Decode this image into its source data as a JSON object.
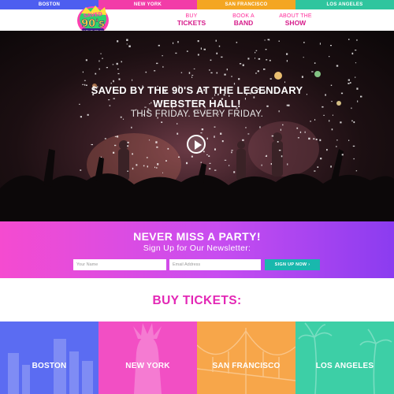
{
  "city_strip": [
    "BOSTON",
    "NEW YORK",
    "SAN FRANCISCO",
    "LOS ANGELES"
  ],
  "logo": {
    "text": "SAVED BY THE 90's"
  },
  "nav": [
    {
      "small": "BUY",
      "big": "TICKETS"
    },
    {
      "small": "BOOK A",
      "big": "BAND"
    },
    {
      "small": "ABOUT THE",
      "big": "SHOW"
    }
  ],
  "hero": {
    "title_line1": "SAVED BY THE 90'S AT THE LEGENDARY",
    "title_line2": "WEBSTER HALL!",
    "subtitle": "THIS FRIDAY. EVERY FRIDAY."
  },
  "newsletter": {
    "title": "NEVER MISS A PARTY!",
    "subtitle": "Sign Up for Our Newsletter:",
    "name_placeholder": "Your Name",
    "email_placeholder": "Email Address",
    "button": "SIGN UP NOW ›"
  },
  "buy": {
    "title": "BUY TICKETS:",
    "tiles": [
      "BOSTON",
      "NEW YORK",
      "SAN FRANCISCO",
      "LOS ANGELES"
    ]
  },
  "colors": {
    "boston": "#4d5ef0",
    "new_york": "#f23ca8",
    "san_francisco": "#f4a622",
    "los_angeles": "#2fc59e",
    "accent_pink": "#e327b5",
    "signup_teal": "#19b8ad"
  }
}
